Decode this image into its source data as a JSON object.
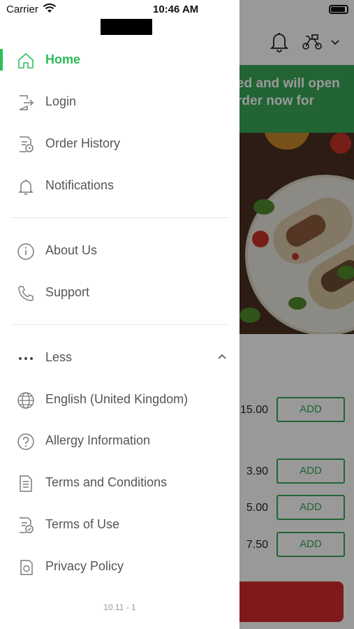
{
  "status_bar": {
    "carrier": "Carrier",
    "time": "10:46 AM"
  },
  "background": {
    "banner_line1": "ed and will open",
    "banner_line2": "rder now for",
    "rows": [
      {
        "price": "15.00",
        "add_label": "ADD"
      },
      {
        "price": "3.90",
        "add_label": "ADD"
      },
      {
        "price": "5.00",
        "add_label": "ADD"
      },
      {
        "price": "7.50",
        "add_label": "ADD"
      }
    ]
  },
  "menu": {
    "home": "Home",
    "login": "Login",
    "order_history": "Order History",
    "notifications": "Notifications",
    "about_us": "About Us",
    "support": "Support",
    "less": "Less",
    "language": "English (United Kingdom)",
    "allergy": "Allergy Information",
    "terms_conditions": "Terms and Conditions",
    "terms_use": "Terms of Use",
    "privacy": "Privacy Policy"
  },
  "version": "10.11 - 1",
  "colors": {
    "accent": "#2dbd59",
    "banner": "#3aa757",
    "cart_button": "#d42c2c"
  }
}
